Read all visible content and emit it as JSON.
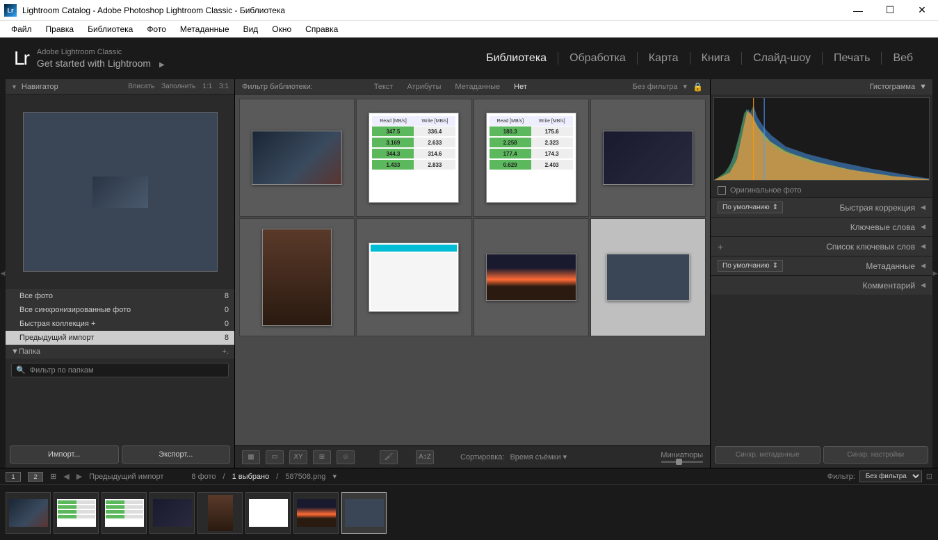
{
  "titlebar": {
    "icon_text": "Lr",
    "title": "Lightroom Catalog - Adobe Photoshop Lightroom Classic - Библиотека"
  },
  "menubar": [
    "Файл",
    "Правка",
    "Библиотека",
    "Фото",
    "Метаданные",
    "Вид",
    "Окно",
    "Справка"
  ],
  "identity": {
    "product": "Adobe Lightroom Classic",
    "get_started": "Get started with Lightroom"
  },
  "modules": [
    {
      "label": "Библиотека",
      "active": true
    },
    {
      "label": "Обработка",
      "active": false
    },
    {
      "label": "Карта",
      "active": false
    },
    {
      "label": "Книга",
      "active": false
    },
    {
      "label": "Слайд-шоу",
      "active": false
    },
    {
      "label": "Печать",
      "active": false
    },
    {
      "label": "Веб",
      "active": false
    }
  ],
  "navigator": {
    "title": "Навигатор",
    "opts": [
      "Вписать",
      "Заполнить",
      "1:1",
      "3:1"
    ]
  },
  "catalog": {
    "items": [
      {
        "label": "Все фото",
        "count": 8,
        "selected": false
      },
      {
        "label": "Все синхронизированные фото",
        "count": 0,
        "selected": false
      },
      {
        "label": "Быстрая коллекция  +",
        "count": 0,
        "selected": false
      },
      {
        "label": "Предыдущий импорт",
        "count": 8,
        "selected": true
      }
    ]
  },
  "folders": {
    "title": "Папка",
    "filter_placeholder": "Фильтр по папкам"
  },
  "left_buttons": {
    "import": "Импорт...",
    "export": "Экспорт..."
  },
  "lib_filter": {
    "label": "Фильтр библиотеки:",
    "tabs": [
      {
        "label": "Текст",
        "active": false
      },
      {
        "label": "Атрибуты",
        "active": false
      },
      {
        "label": "Метаданные",
        "active": false
      },
      {
        "label": "Нет",
        "active": true
      }
    ],
    "no_filter": "Без фильтра"
  },
  "benchmark1": {
    "read_label": "Read [MB/s]",
    "write_label": "Write [MB/s]",
    "rows": [
      {
        "r": "347.5",
        "w": "336.4"
      },
      {
        "r": "3.169",
        "w": "2.633"
      },
      {
        "r": "344.3",
        "w": "314.6"
      },
      {
        "r": "1.433",
        "w": "2.833"
      }
    ]
  },
  "benchmark2": {
    "rows": [
      {
        "r": "180.3",
        "w": "175.6"
      },
      {
        "r": "2.258",
        "w": "2.323"
      },
      {
        "r": "177.4",
        "w": "174.3"
      },
      {
        "r": "0.629",
        "w": "2.403"
      }
    ]
  },
  "toolbar": {
    "sort_label": "Сортировка:",
    "sort_value": "Время съёмки",
    "thumb_label": "Миниатюры"
  },
  "right": {
    "histogram": "Гистограмма",
    "original": "Оригинальное фото",
    "panels": [
      {
        "label": "Быстрая коррекция",
        "preset": "По умолчанию"
      },
      {
        "label": "Ключевые слова"
      },
      {
        "label": "Список ключевых слов",
        "plus": true
      },
      {
        "label": "Метаданные",
        "preset": "По умолчанию"
      },
      {
        "label": "Комментарий"
      }
    ],
    "sync_meta": "Синхр. метаданные",
    "sync_settings": "Синхр. настройки"
  },
  "filmstrip": {
    "monitor1": "1",
    "monitor2": "2",
    "source": "Предыдущий импорт",
    "count": "8 фото",
    "selected": "1 выбрано",
    "filename": "587508.png",
    "filter_label": "Фильтр:",
    "filter_value": "Без фильтра"
  }
}
